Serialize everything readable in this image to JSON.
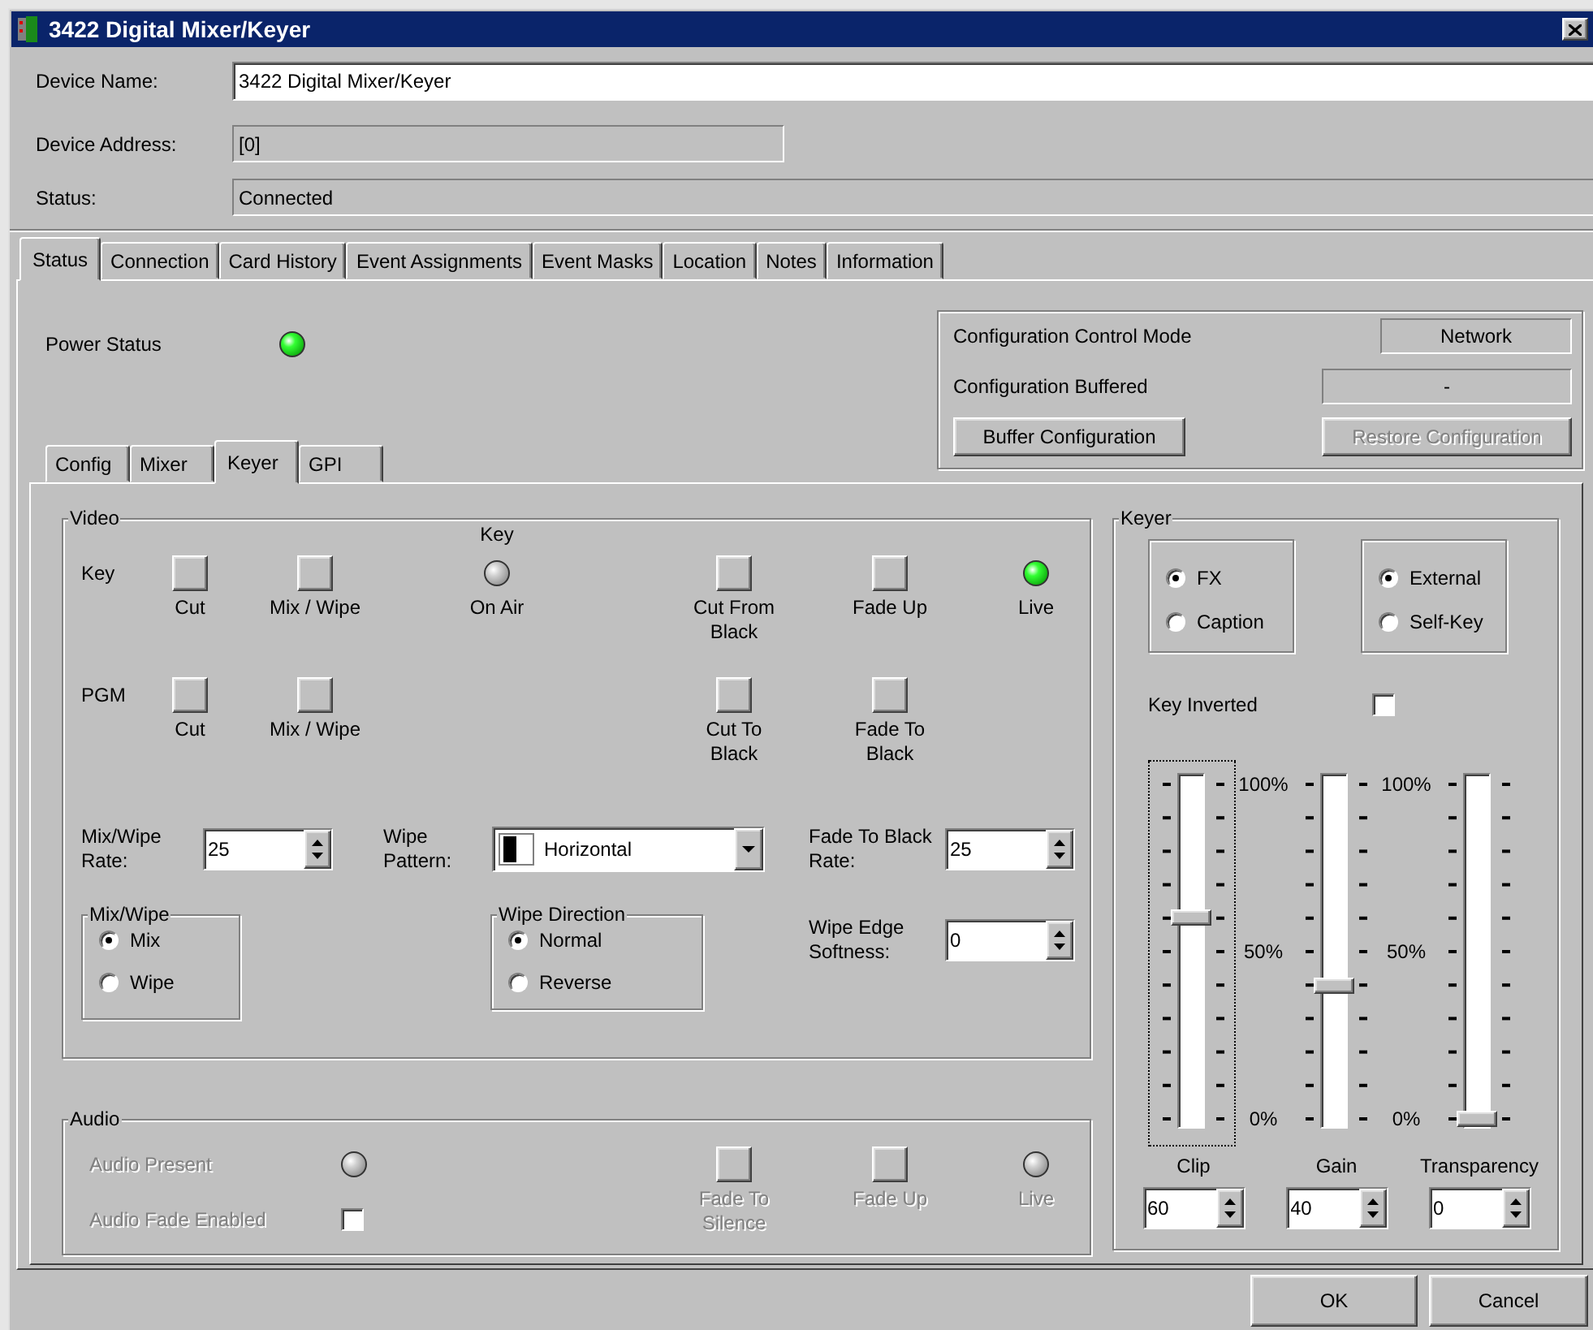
{
  "window": {
    "title": "3422 Digital Mixer/Keyer"
  },
  "device_fields": [
    {
      "label": "Device Name:",
      "value": "3422 Digital Mixer/Keyer",
      "kind": "edit"
    },
    {
      "label": "Device Address:",
      "value": "[0]",
      "kind": "readonly"
    },
    {
      "label": "Status:",
      "value": "Connected",
      "kind": "readonly"
    }
  ],
  "tabs": [
    {
      "label": "Status",
      "selected": true
    },
    {
      "label": "Connection",
      "selected": false
    },
    {
      "label": "Card History",
      "selected": false
    },
    {
      "label": "Event Assignments",
      "selected": false
    },
    {
      "label": "Event Masks",
      "selected": false
    },
    {
      "label": "Location",
      "selected": false
    },
    {
      "label": "Notes",
      "selected": false
    },
    {
      "label": "Information",
      "selected": false
    }
  ],
  "power_status": {
    "label": "Power Status",
    "on": true
  },
  "configuration": {
    "rows": [
      {
        "label": "Configuration Control Mode",
        "value": "Network"
      },
      {
        "label": "Configuration Buffered",
        "value": "-"
      }
    ],
    "buttons": [
      {
        "label": "Buffer Configuration",
        "disabled": false
      },
      {
        "label": "Restore Configuration",
        "disabled": true
      }
    ]
  },
  "subtabs": [
    {
      "label": "Config",
      "selected": false
    },
    {
      "label": "Mixer",
      "selected": false
    },
    {
      "label": "Keyer",
      "selected": true
    },
    {
      "label": "GPI",
      "selected": false
    }
  ],
  "video": {
    "title": "Video",
    "rows": [
      {
        "label": "Key",
        "items": [
          {
            "kind": "button",
            "caption": "Cut"
          },
          {
            "kind": "button",
            "caption": "Mix / Wipe"
          },
          {
            "kind": "led",
            "top_label": "Key",
            "caption": "On Air",
            "on": false
          },
          {
            "kind": "button",
            "caption": "Cut From Black"
          },
          {
            "kind": "button",
            "caption": "Fade Up"
          },
          {
            "kind": "led",
            "caption": "Live",
            "on": true
          }
        ]
      },
      {
        "label": "PGM",
        "items": [
          {
            "kind": "button",
            "caption": "Cut"
          },
          {
            "kind": "button",
            "caption": "Mix / Wipe"
          },
          {
            "kind": "button",
            "caption": "Cut To Black"
          },
          {
            "kind": "button",
            "caption": "Fade To Black"
          }
        ]
      }
    ],
    "mix_wipe_rate": {
      "label": "Mix/Wipe Rate:",
      "value": "25"
    },
    "wipe_pattern": {
      "label": "Wipe Pattern:",
      "value": "Horizontal"
    },
    "fade_to_black_rate": {
      "label": "Fade To Black Rate:",
      "value": "25"
    },
    "mix_wipe": {
      "title": "Mix/Wipe",
      "options": [
        {
          "label": "Mix",
          "selected": true
        },
        {
          "label": "Wipe",
          "selected": false
        }
      ]
    },
    "wipe_direction": {
      "title": "Wipe Direction",
      "options": [
        {
          "label": "Normal",
          "selected": true
        },
        {
          "label": "Reverse",
          "selected": false
        }
      ]
    },
    "wipe_edge_softness": {
      "label": "Wipe Edge Softness:",
      "value": "0"
    }
  },
  "audio": {
    "title": "Audio",
    "disabled": true,
    "audio_present": {
      "label": "Audio Present",
      "on": false
    },
    "audio_fade_enabled": {
      "label": "Audio Fade Enabled",
      "checked": false
    },
    "items": [
      {
        "kind": "button",
        "caption": "Fade To Silence"
      },
      {
        "kind": "button",
        "caption": "Fade Up"
      },
      {
        "kind": "led",
        "caption": "Live",
        "on": false
      }
    ]
  },
  "keyer": {
    "title": "Keyer",
    "mode_groups": [
      {
        "options": [
          {
            "label": "FX",
            "selected": true
          },
          {
            "label": "Caption",
            "selected": false
          }
        ]
      },
      {
        "options": [
          {
            "label": "External",
            "selected": true
          },
          {
            "label": "Self-Key",
            "selected": false
          }
        ]
      }
    ],
    "key_inverted": {
      "label": "Key Inverted",
      "checked": false
    },
    "sliders": [
      {
        "label": "Clip",
        "level": 0.6,
        "value": "60",
        "focused": true
      },
      {
        "label": "Gain",
        "level": 0.4,
        "value": "40",
        "focused": false
      },
      {
        "label": "Transparency",
        "level": 0,
        "value": "0",
        "focused": false
      }
    ],
    "scales": [
      [
        "100%",
        "50%",
        "0%"
      ],
      [
        "100%",
        "50%",
        "0%"
      ]
    ]
  },
  "buttons": [
    {
      "label": "OK"
    },
    {
      "label": "Cancel"
    }
  ]
}
